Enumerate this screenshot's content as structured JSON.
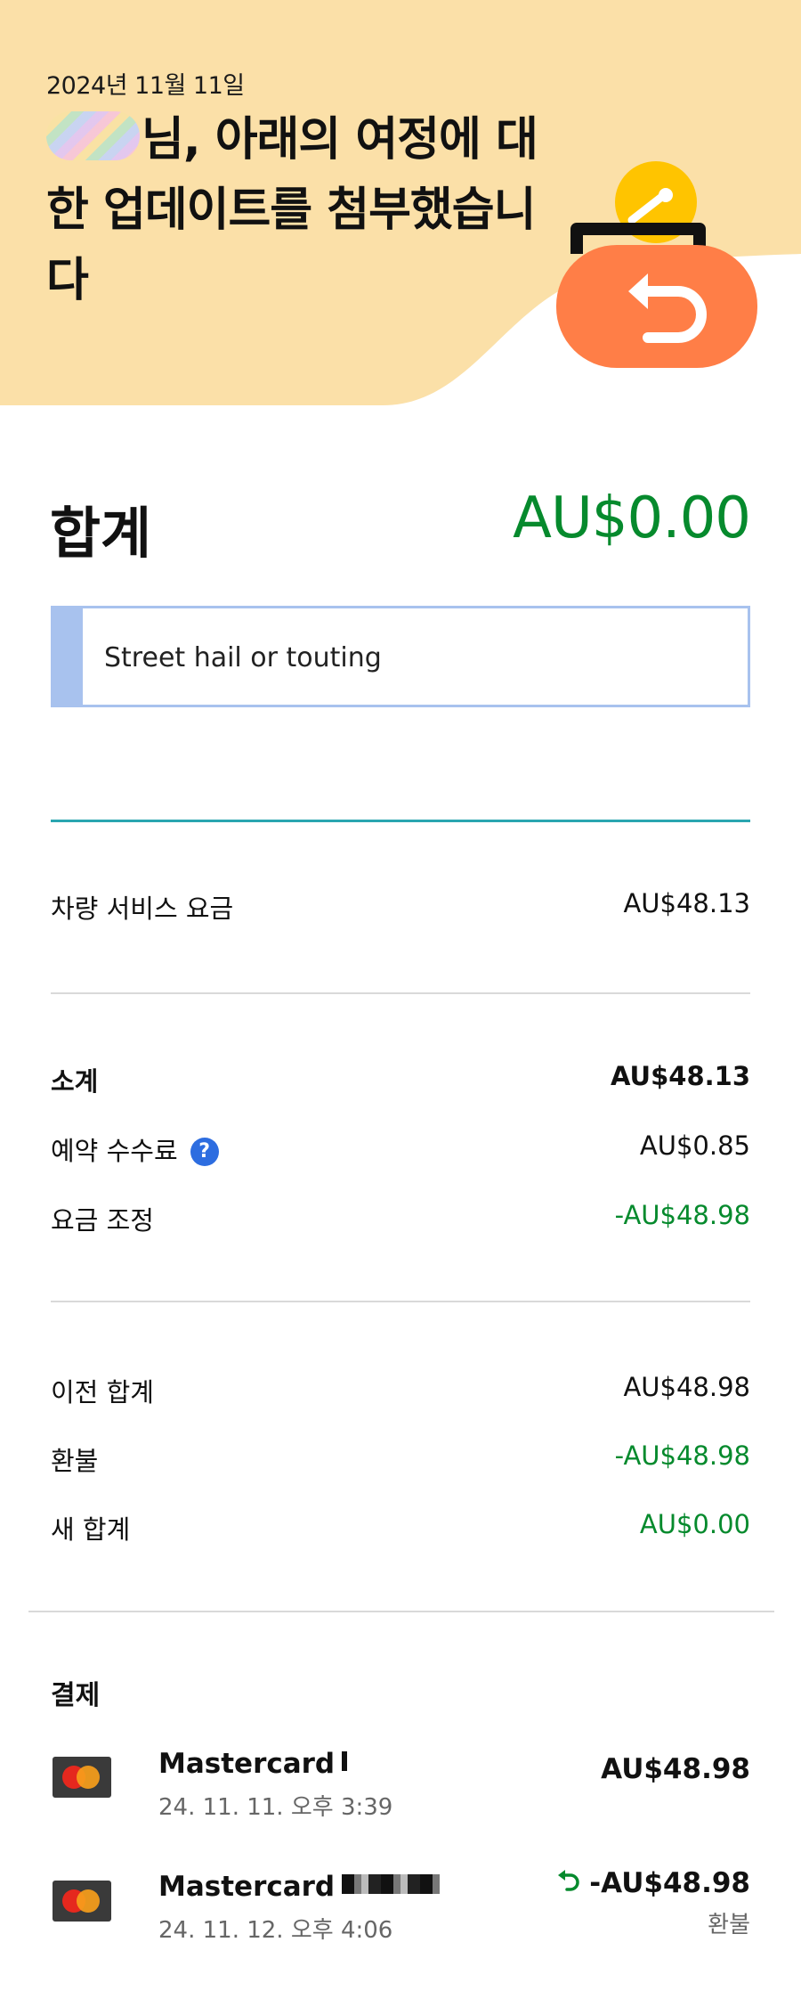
{
  "hero": {
    "date": "2024년 11월 11일",
    "title": "님, 아래의 여정에 대한 업데이트를 첨부했습니다"
  },
  "summary": {
    "total_label": "합계",
    "total_value": "AU$0.00"
  },
  "notice": {
    "text": "Street hail or touting"
  },
  "charges": [
    {
      "label": "차량 서비스 요금",
      "value": "AU$48.13"
    }
  ],
  "subtotals": [
    {
      "label": "소계",
      "value": "AU$48.13"
    },
    {
      "label": "예약 수수료",
      "value": "AU$0.85"
    },
    {
      "label": "요금 조정",
      "value": "-AU$48.98"
    }
  ],
  "totals": [
    {
      "label": "이전 합계",
      "value": "AU$48.98"
    },
    {
      "label": "환불",
      "value": "-AU$48.98"
    },
    {
      "label": "새 합계",
      "value": "AU$0.00"
    }
  ],
  "payments": {
    "title": "결제",
    "items": [
      {
        "name": "Mastercard",
        "date": "24. 11. 11. 오후 3:39",
        "amount": "AU$48.98",
        "note": ""
      },
      {
        "name": "Mastercard",
        "date": "24. 11. 12. 오후 4:06",
        "amount": "-AU$48.98",
        "note": "환불"
      }
    ]
  },
  "colors": {
    "hero_bg": "#fbe0a8",
    "positive_green": "#068a2d",
    "notice_blue": "#a8c2ee",
    "wallet_orange": "#ff7e47",
    "coin_yellow": "#ffc400",
    "divider_teal": "#2aa6b0"
  },
  "icons": {
    "wallet": "wallet-refund-icon",
    "help": "question-circle-icon",
    "card": "mastercard-icon",
    "refund": "refund-arrow-icon"
  }
}
